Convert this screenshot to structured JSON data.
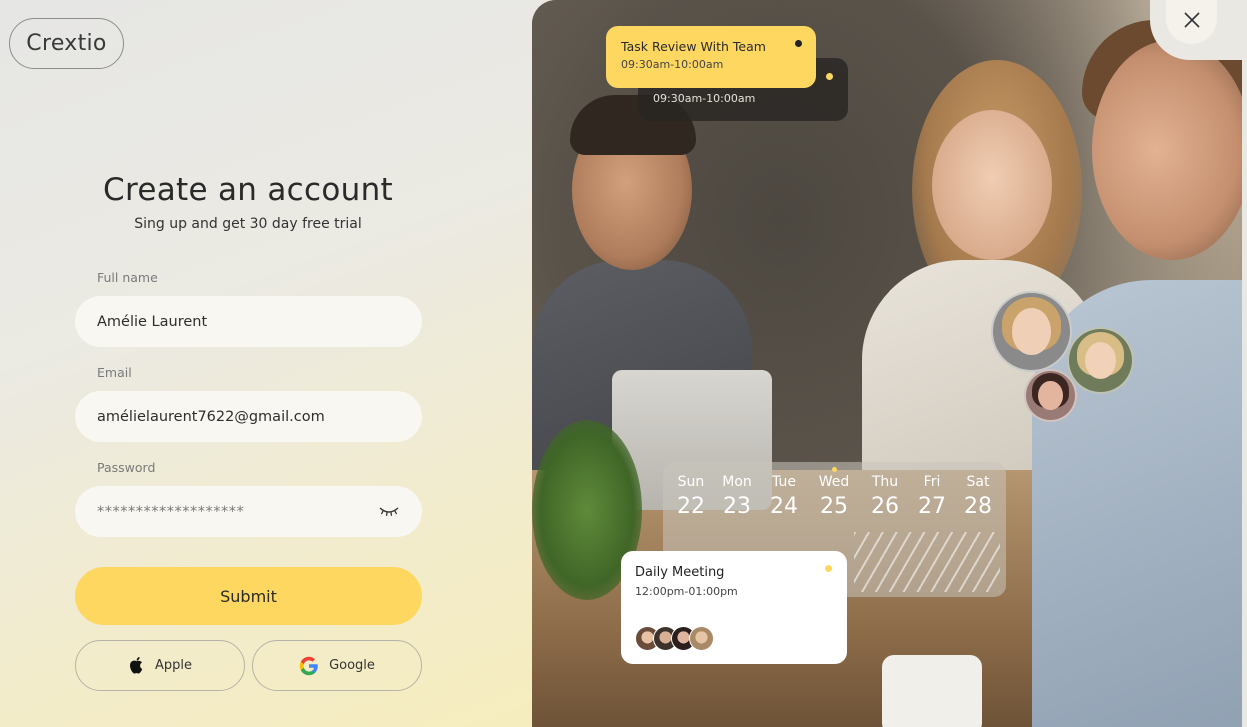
{
  "brand": {
    "name": "Crextio"
  },
  "form": {
    "heading": "Create an account",
    "subheading": "Sing up and get 30 day free trial",
    "fullname": {
      "label": "Full name",
      "value": "Amélie Laurent"
    },
    "email": {
      "label": "Email",
      "value": "amélielaurent7622@gmail.com"
    },
    "password": {
      "label": "Password",
      "value": "*******************"
    },
    "submit_label": "Submit",
    "apple_label": "Apple",
    "google_label": "Google"
  },
  "overlay": {
    "task_back": {
      "time": "09:30am-10:00am"
    },
    "task": {
      "title": "Task Review With Team",
      "time": "09:30am-10:00am"
    },
    "calendar": {
      "days": [
        {
          "name": "Sun",
          "num": "22"
        },
        {
          "name": "Mon",
          "num": "23"
        },
        {
          "name": "Tue",
          "num": "24"
        },
        {
          "name": "Wed",
          "num": "25"
        },
        {
          "name": "Thu",
          "num": "26"
        },
        {
          "name": "Fri",
          "num": "27"
        },
        {
          "name": "Sat",
          "num": "28"
        }
      ]
    },
    "meeting": {
      "title": "Daily Meeting",
      "time": "12:00pm-01:00pm"
    }
  },
  "colors": {
    "accent": "#fdd760",
    "panel_bg": "#e9e8e3",
    "field_bg": "#f8f7f1"
  },
  "icons": [
    "eye-closed-icon",
    "apple-icon",
    "google-icon",
    "close-icon"
  ]
}
